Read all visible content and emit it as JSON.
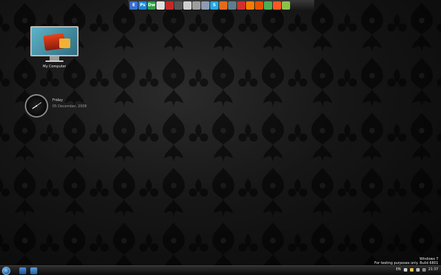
{
  "colors": {
    "accent": "#5fb3c7",
    "taskbar": "#1a1a1a",
    "text": "#e6e6e6"
  },
  "dock": {
    "items": [
      {
        "name": "app-icon",
        "color": "#3b6fd0",
        "glyph": "E"
      },
      {
        "name": "photoshop-icon",
        "color": "#1e88d8",
        "glyph": "Ps"
      },
      {
        "name": "dreamweaver-icon",
        "color": "#2f9e44",
        "glyph": "Dw"
      },
      {
        "name": "app-icon",
        "color": "#e0e0e0",
        "glyph": ""
      },
      {
        "name": "app-icon",
        "color": "#c62828",
        "glyph": ""
      },
      {
        "name": "app-icon",
        "color": "#555555",
        "glyph": ""
      },
      {
        "name": "disc-icon",
        "color": "#cfcfcf",
        "glyph": ""
      },
      {
        "name": "app-icon",
        "color": "#9e9e9e",
        "glyph": ""
      },
      {
        "name": "app-icon",
        "color": "#8e9bb5",
        "glyph": ""
      },
      {
        "name": "skype-icon",
        "color": "#29a8e0",
        "glyph": "S"
      },
      {
        "name": "firefox-icon",
        "color": "#e36b1b",
        "glyph": ""
      },
      {
        "name": "app-icon",
        "color": "#607d8b",
        "glyph": ""
      },
      {
        "name": "app-icon",
        "color": "#d32f2f",
        "glyph": ""
      },
      {
        "name": "app-icon",
        "color": "#f57c00",
        "glyph": ""
      },
      {
        "name": "app-icon",
        "color": "#e65100",
        "glyph": ""
      },
      {
        "name": "app-icon",
        "color": "#4caf50",
        "glyph": ""
      },
      {
        "name": "app-icon",
        "color": "#ff5722",
        "glyph": ""
      },
      {
        "name": "app-icon",
        "color": "#8bc34a",
        "glyph": ""
      }
    ]
  },
  "desktop": {
    "my_computer_label": "My Computer"
  },
  "clock_gadget": {
    "day": "Friday",
    "date": "05 December, 2008"
  },
  "watermark": {
    "line1": "Windows 7",
    "line2": "For testing purposes only. Build 6801"
  },
  "taskbar": {
    "language": "EN",
    "time": "21:37"
  }
}
